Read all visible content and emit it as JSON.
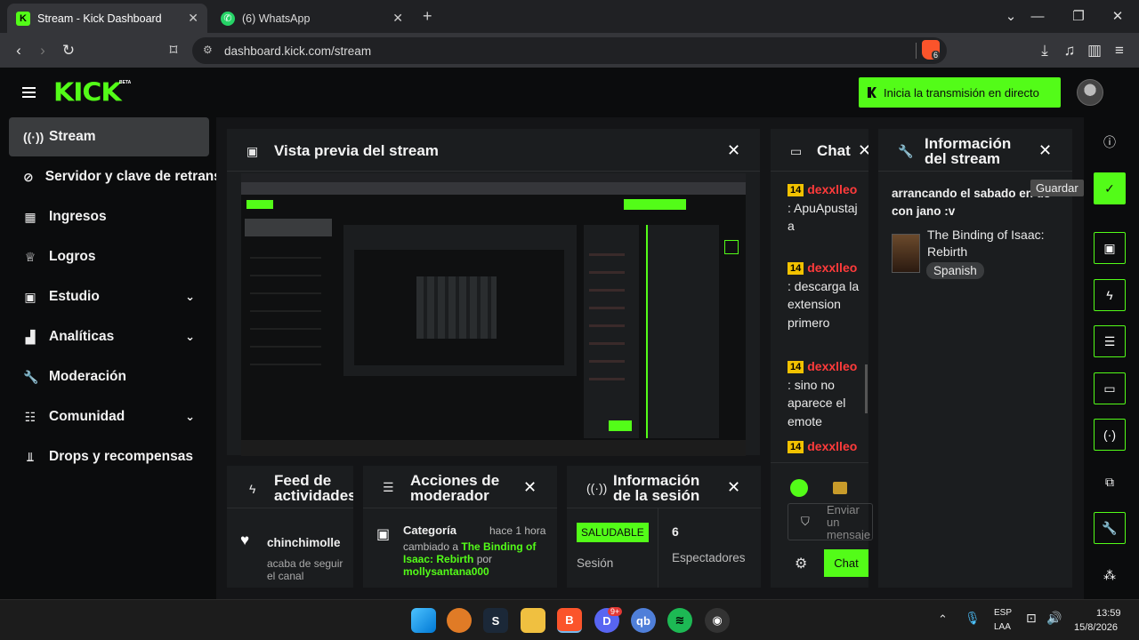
{
  "browser": {
    "tabs": [
      {
        "title": "Stream - Kick Dashboard",
        "active": true,
        "favicon": "kick-icon"
      },
      {
        "title": "(6) WhatsApp",
        "active": false,
        "favicon": "whatsapp-icon"
      }
    ],
    "new_tab": "+",
    "url": "dashboard.kick.com/stream",
    "brave_badge": "6"
  },
  "header": {
    "logo": "KICK",
    "logo_badge": "BETA",
    "go_live_label": "Inicia la transmisión en directo"
  },
  "sidebar": {
    "items": [
      {
        "label": "Stream",
        "icon": "broadcast-icon",
        "active": true,
        "chevron": false
      },
      {
        "label": "Servidor y clave de retransmisión",
        "icon": "link-icon",
        "active": false,
        "chevron": false
      },
      {
        "label": "Ingresos",
        "icon": "chart-icon",
        "active": false,
        "chevron": false
      },
      {
        "label": "Logros",
        "icon": "trophy-icon",
        "active": false,
        "chevron": false
      },
      {
        "label": "Estudio",
        "icon": "studio-icon",
        "active": false,
        "chevron": true
      },
      {
        "label": "Analíticas",
        "icon": "analytics-icon",
        "active": false,
        "chevron": true
      },
      {
        "label": "Moderación",
        "icon": "wrench-icon",
        "active": false,
        "chevron": false
      },
      {
        "label": "Comunidad",
        "icon": "community-icon",
        "active": false,
        "chevron": true
      },
      {
        "label": "Drops y recompensas",
        "icon": "drops-icon",
        "active": false,
        "chevron": false
      }
    ]
  },
  "preview": {
    "title": "Vista previa del stream"
  },
  "chat": {
    "title": "Chat",
    "messages": [
      {
        "badge": "14",
        "user": "dexxlleo",
        "text": ": ApuApustaja"
      },
      {
        "badge": "14",
        "user": "dexxlleo",
        "text": ": descarga la extension primero"
      },
      {
        "badge": "14",
        "user": "dexxlleo",
        "text": ": sino no aparece el emote"
      },
      {
        "badge": "14",
        "user": "dexxlleo",
        "text": ""
      }
    ],
    "input_placeholder": "Enviar un mensaje",
    "send_label": "Chat"
  },
  "stream_info": {
    "title_line1": "Información",
    "title_line2": "del stream",
    "stream_title": "arrancando el sabado en ds con jano :v",
    "category": "The Binding of Isaac: Rebirth",
    "language": "Spanish",
    "tooltip": "Guardar"
  },
  "activity_feed": {
    "title_line1": "Feed de",
    "title_line2": "actividades",
    "item_user": "chinchimolle",
    "item_text": "acaba de seguir el canal"
  },
  "mod_actions": {
    "title_line1": "Acciones de",
    "title_line2": "moderador",
    "item_label": "Categoría",
    "item_time": "hace 1 hora",
    "item_text_prefix": "cambiado a ",
    "item_target": "The Binding of Isaac: Rebirth",
    "item_by": " por ",
    "item_user": "mollysantana000"
  },
  "session_info": {
    "title_line1": "Información",
    "title_line2": "de la sesión",
    "status": "SALUDABLE",
    "status_label": "Sesión",
    "viewers": "6",
    "viewers_label": "Espectadores"
  },
  "taskbar": {
    "lang": "ESP",
    "lang_sub": "LAA",
    "time": "13:59",
    "date": "15/8/2026",
    "discord_badge": "9+"
  },
  "colors": {
    "accent": "#53fc18",
    "bg": "#0b0c0d",
    "panel": "#1b1d1f",
    "username": "#ff3b3b"
  }
}
